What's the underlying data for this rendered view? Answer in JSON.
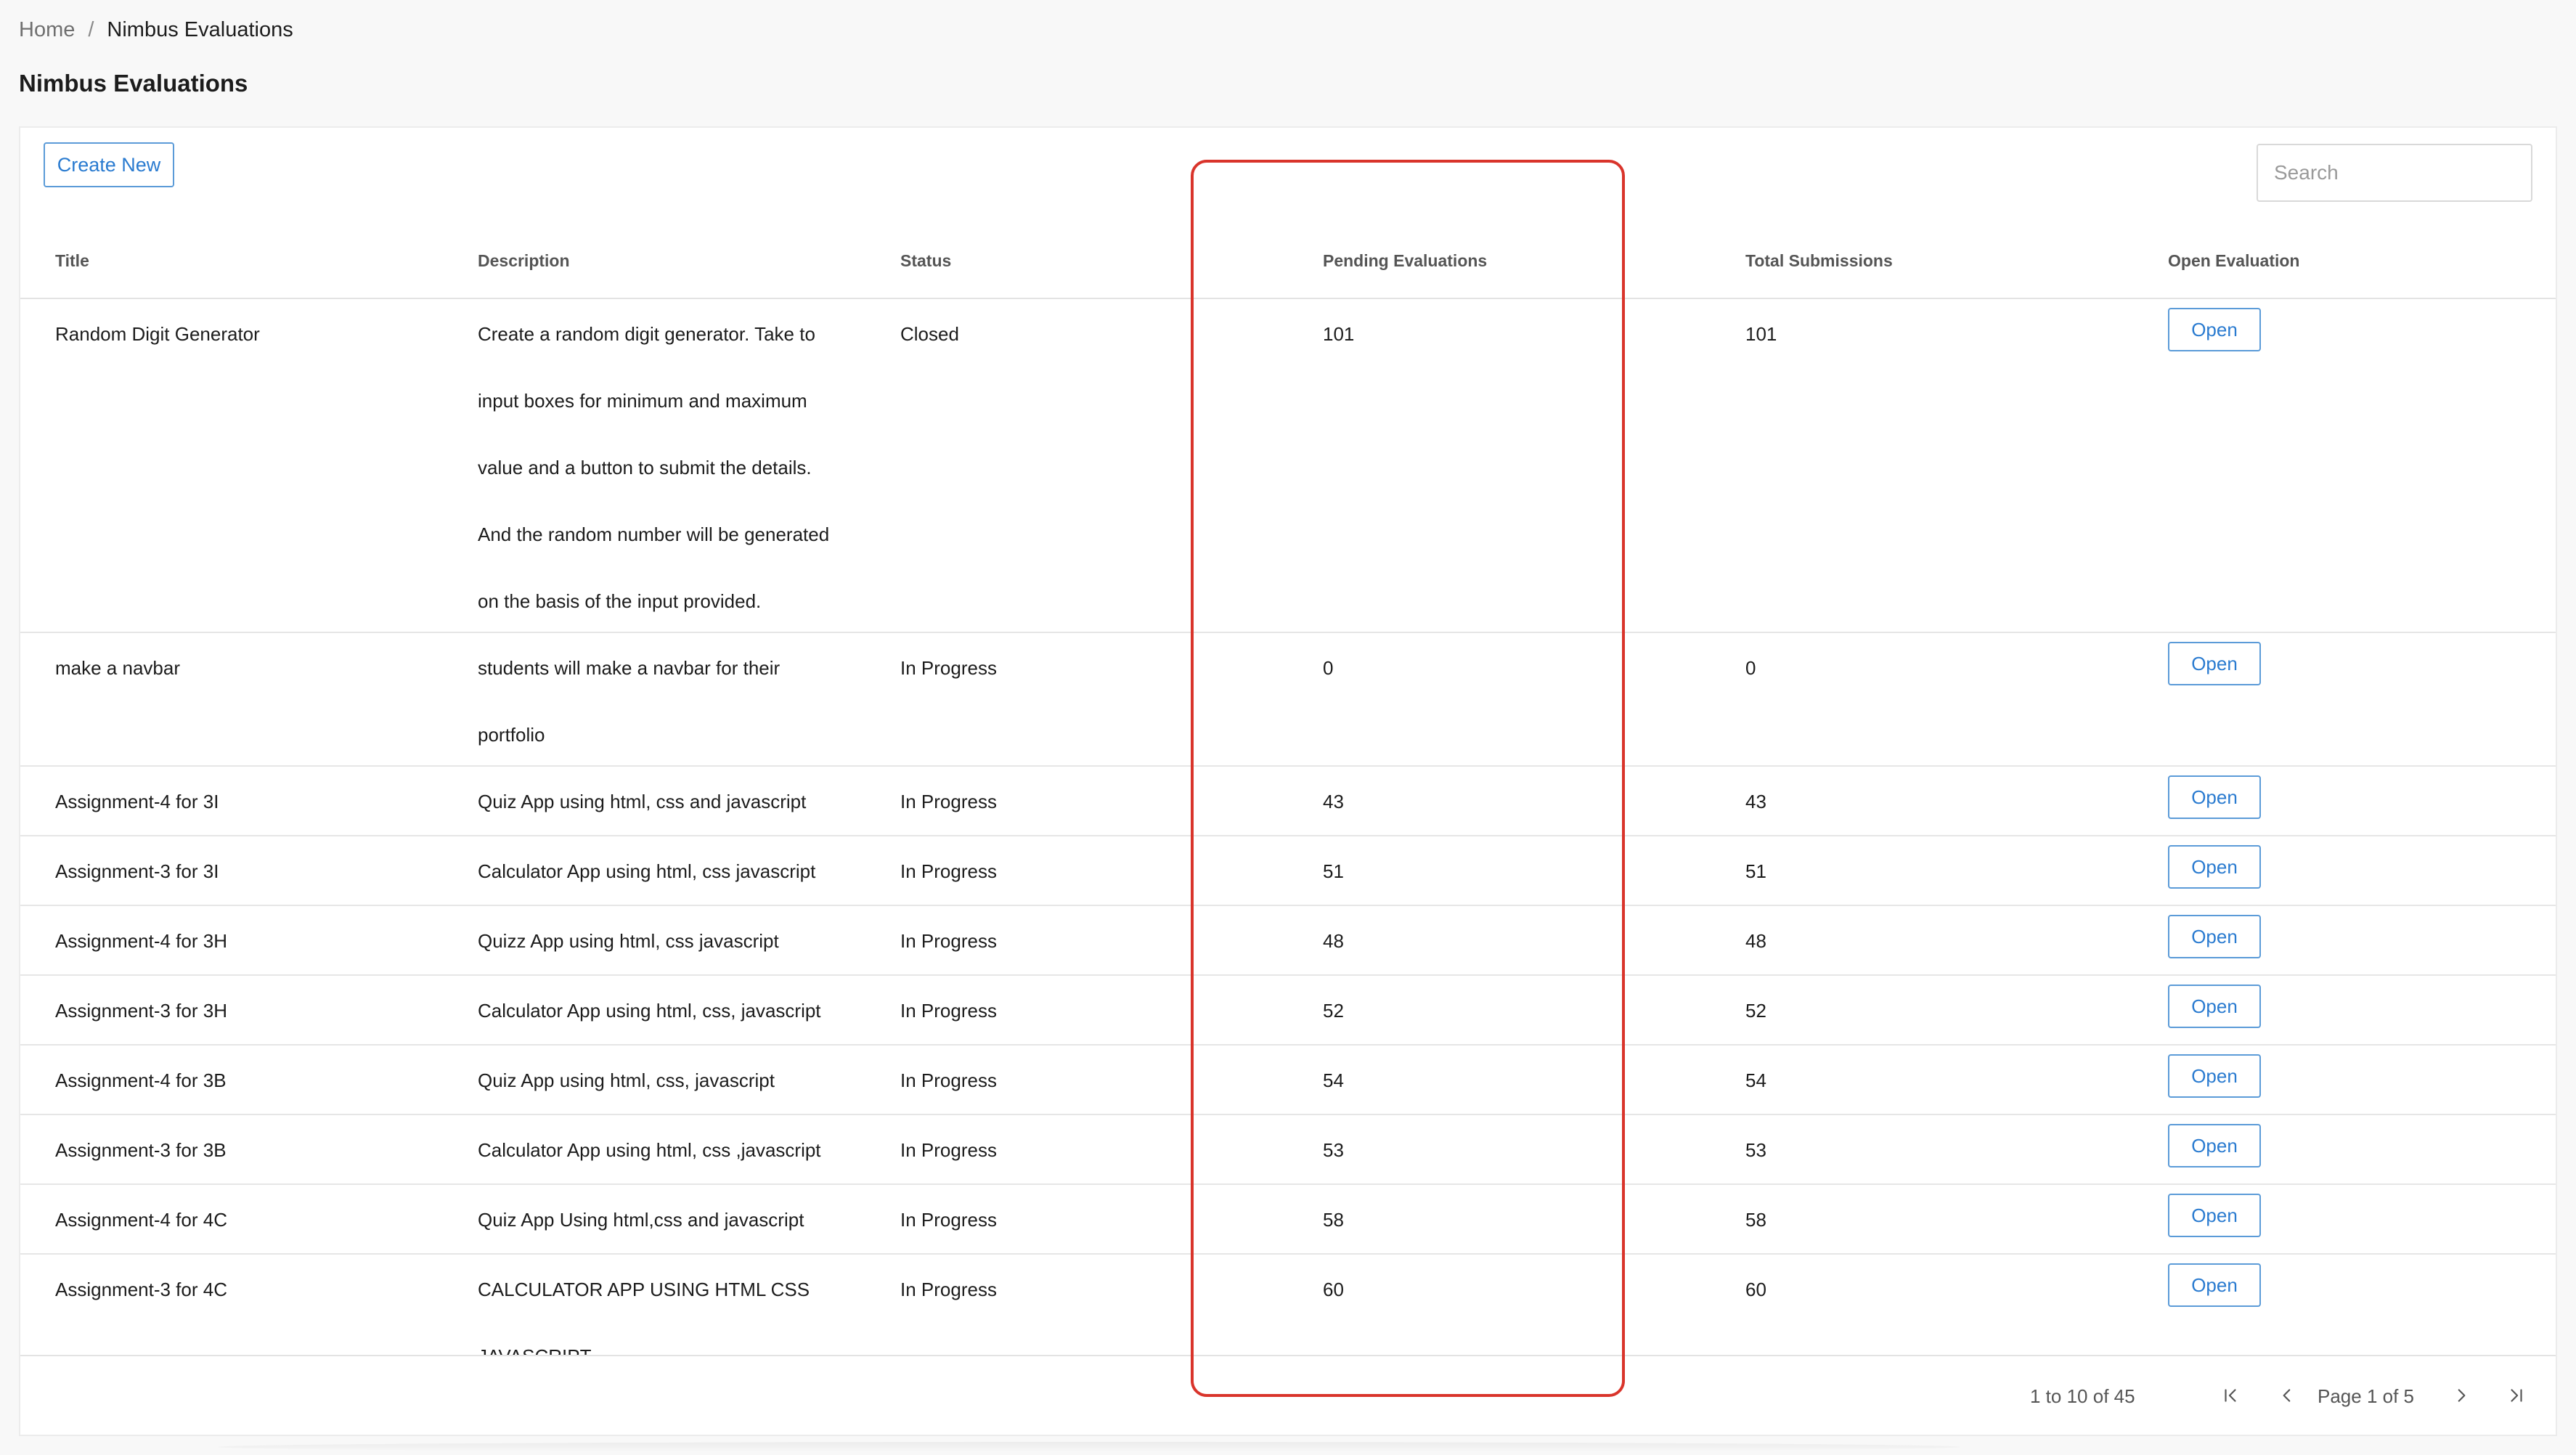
{
  "breadcrumb": {
    "home": "Home",
    "separator": "/",
    "current": "Nimbus Evaluations"
  },
  "page_title": "Nimbus Evaluations",
  "toolbar": {
    "create_label": "Create New"
  },
  "search": {
    "placeholder": "Search"
  },
  "table": {
    "headers": {
      "title": "Title",
      "description": "Description",
      "status": "Status",
      "pending": "Pending Evaluations",
      "total": "Total Submissions",
      "open": "Open Evaluation"
    },
    "rows": [
      {
        "title": "Random Digit Generator",
        "description_lines": [
          "Create a random digit generator. Take to",
          "input boxes for minimum and maximum",
          "value and a button to submit the details.",
          "And the random number will be generated",
          "on the basis of the input provided."
        ],
        "status": "Closed",
        "pending": "101",
        "total": "101",
        "open_label": "Open"
      },
      {
        "title": "make a navbar",
        "description_lines": [
          "students will make a navbar for their",
          "portfolio"
        ],
        "status": "In Progress",
        "pending": "0",
        "total": "0",
        "open_label": "Open"
      },
      {
        "title": "Assignment-4 for 3I",
        "description_lines": [
          "Quiz App using html, css and javascript"
        ],
        "status": "In Progress",
        "pending": "43",
        "total": "43",
        "open_label": "Open"
      },
      {
        "title": "Assignment-3 for 3I",
        "description_lines": [
          "Calculator App using html, css javascript"
        ],
        "status": "In Progress",
        "pending": "51",
        "total": "51",
        "open_label": "Open"
      },
      {
        "title": "Assignment-4 for 3H",
        "description_lines": [
          "Quizz App using html, css javascript"
        ],
        "status": "In Progress",
        "pending": "48",
        "total": "48",
        "open_label": "Open"
      },
      {
        "title": "Assignment-3 for 3H",
        "description_lines": [
          "Calculator App using html, css, javascript"
        ],
        "status": "In Progress",
        "pending": "52",
        "total": "52",
        "open_label": "Open"
      },
      {
        "title": "Assignment-4 for 3B",
        "description_lines": [
          "Quiz App using html, css, javascript"
        ],
        "status": "In Progress",
        "pending": "54",
        "total": "54",
        "open_label": "Open"
      },
      {
        "title": "Assignment-3 for 3B",
        "description_lines": [
          "Calculator App using html, css ,javascript"
        ],
        "status": "In Progress",
        "pending": "53",
        "total": "53",
        "open_label": "Open"
      },
      {
        "title": "Assignment-4 for 4C",
        "description_lines": [
          "Quiz App Using html,css and javascript"
        ],
        "status": "In Progress",
        "pending": "58",
        "total": "58",
        "open_label": "Open"
      },
      {
        "title": "Assignment-3 for 4C",
        "description_lines": [
          "CALCULATOR APP USING HTML CSS",
          "JAVASCRIPT"
        ],
        "status": "In Progress",
        "pending": "60",
        "total": "60",
        "open_label": "Open"
      }
    ]
  },
  "pagination": {
    "range": "1 to 10 of 45",
    "page_label": "Page 1 of 5"
  },
  "colors": {
    "accent": "#2a7bd0",
    "highlight": "#d9342b"
  },
  "icons": [
    "first-page-icon",
    "prev-page-icon",
    "next-page-icon",
    "last-page-icon"
  ]
}
